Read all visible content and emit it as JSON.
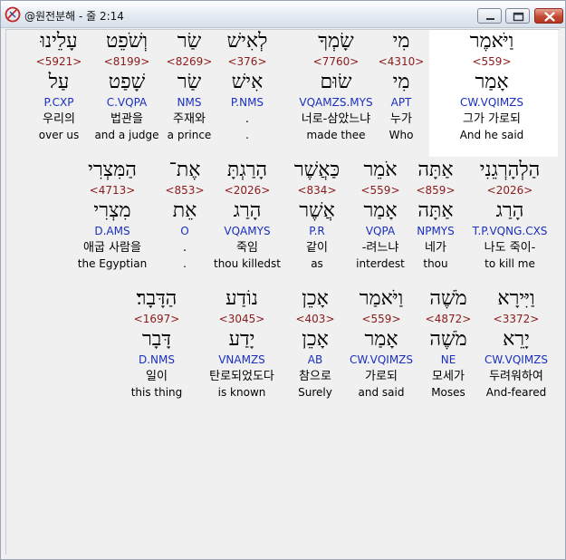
{
  "window": {
    "title": "@원전분해 - 줄 2:14",
    "icon": "app-logo-icon",
    "controls": [
      "minimize-icon",
      "maximize-icon",
      "close-icon"
    ]
  },
  "colors": {
    "strong_number": "#8b1a1a",
    "parsing": "#1a2fbf",
    "text": "#000000",
    "selected_background": "#ffffff",
    "panel_background": "#f0f0f0"
  },
  "rows": [
    {
      "words": [
        {
          "hebrew": "וַיֹּאמֶר",
          "strong": "<559>",
          "lemma": "אָמַר",
          "parse": "CW.VQIMZS",
          "korean": "그가 가로되",
          "english": "And he said"
        },
        {
          "hebrew": "מִי",
          "strong": "<4310>",
          "lemma": "מִי",
          "parse": "APT",
          "korean": "누가",
          "english": "Who"
        },
        {
          "hebrew": "שָׂמְךָ",
          "strong": "<7760>",
          "lemma": "שׂוּם",
          "parse": "VQAMZS.MYS",
          "korean": "너로-삼았느냐",
          "english": "made thee"
        },
        {
          "hebrew": "לְאִישׁ",
          "strong": "<376>",
          "lemma": "אִישׁ",
          "parse": "P.NMS",
          "korean": ".",
          "english": "."
        },
        {
          "hebrew": "שַׂר",
          "strong": "<8269>",
          "lemma": "שַׂר",
          "parse": "NMS",
          "korean": "주재와",
          "english": "a prince"
        },
        {
          "hebrew": "וְשֹׁפֵט",
          "strong": "<8199>",
          "lemma": "שָׁפַט",
          "parse": "C.VQPA",
          "korean": "법관을",
          "english": "and a judge"
        },
        {
          "hebrew": "עָלֵינוּ",
          "strong": "<5921>",
          "lemma": "עַל",
          "parse": "P.CXP",
          "korean": "우리의",
          "english": "over us"
        }
      ]
    },
    {
      "words": [
        {
          "hebrew": "הַלְהָרְגֵנִי",
          "strong": "<2026>",
          "lemma": "הָרַג",
          "parse": "T.P.VQNG.CXS",
          "korean": "나도 죽이-",
          "english": "to kill me"
        },
        {
          "hebrew": "אַתָּה",
          "strong": "<859>",
          "lemma": "אַתָּה",
          "parse": "NPMYS",
          "korean": "네가",
          "english": "thou"
        },
        {
          "hebrew": "אֹמֵר",
          "strong": "<559>",
          "lemma": "אָמַר",
          "parse": "VQPA",
          "korean": "-려느냐",
          "english": "interdest"
        },
        {
          "hebrew": "כַּאֲשֶׁר",
          "strong": "<834>",
          "lemma": "אֲשֶׁר",
          "parse": "P.R",
          "korean": "같이",
          "english": "as"
        },
        {
          "hebrew": "הָרַגְתָּ",
          "strong": "<2026>",
          "lemma": "הָרַג",
          "parse": "VQAMYS",
          "korean": "죽임",
          "english": "thou killedst"
        },
        {
          "hebrew": "אֶת־",
          "strong": "<853>",
          "lemma": "אֵת",
          "parse": "O",
          "korean": ".",
          "english": "."
        },
        {
          "hebrew": "הַמִּצְרִי",
          "strong": "<4713>",
          "lemma": "מִצְרִי",
          "parse": "D.AMS",
          "korean": "애굽 사람을",
          "english": "the Egyptian"
        }
      ]
    },
    {
      "words": [
        {
          "hebrew": "וַיִּירָא",
          "strong": "<3372>",
          "lemma": "יָרֵא",
          "parse": "CW.VQIMZS",
          "korean": "두려워하여",
          "english": "And-feared"
        },
        {
          "hebrew": "מֹשֶׁה",
          "strong": "<4872>",
          "lemma": "מֹשֶׁה",
          "parse": "NE",
          "korean": "모세가",
          "english": "Moses"
        },
        {
          "hebrew": "וַיֹּאמַר",
          "strong": "<559>",
          "lemma": "אָמַר",
          "parse": "CW.VQIMZS",
          "korean": "가로되",
          "english": "and said"
        },
        {
          "hebrew": "אָכֵן",
          "strong": "<403>",
          "lemma": "אָכֵן",
          "parse": "AB",
          "korean": "참으로",
          "english": "Surely"
        },
        {
          "hebrew": "נוֹדַע",
          "strong": "<3045>",
          "lemma": "יָדַע",
          "parse": "VNAMZS",
          "korean": "탄로되었도다",
          "english": "is known"
        },
        {
          "hebrew": "הַדָּבָר׃",
          "strong": "<1697>",
          "lemma": "דָּבָר",
          "parse": "D.NMS",
          "korean": "일이",
          "english": "this thing"
        }
      ]
    }
  ]
}
